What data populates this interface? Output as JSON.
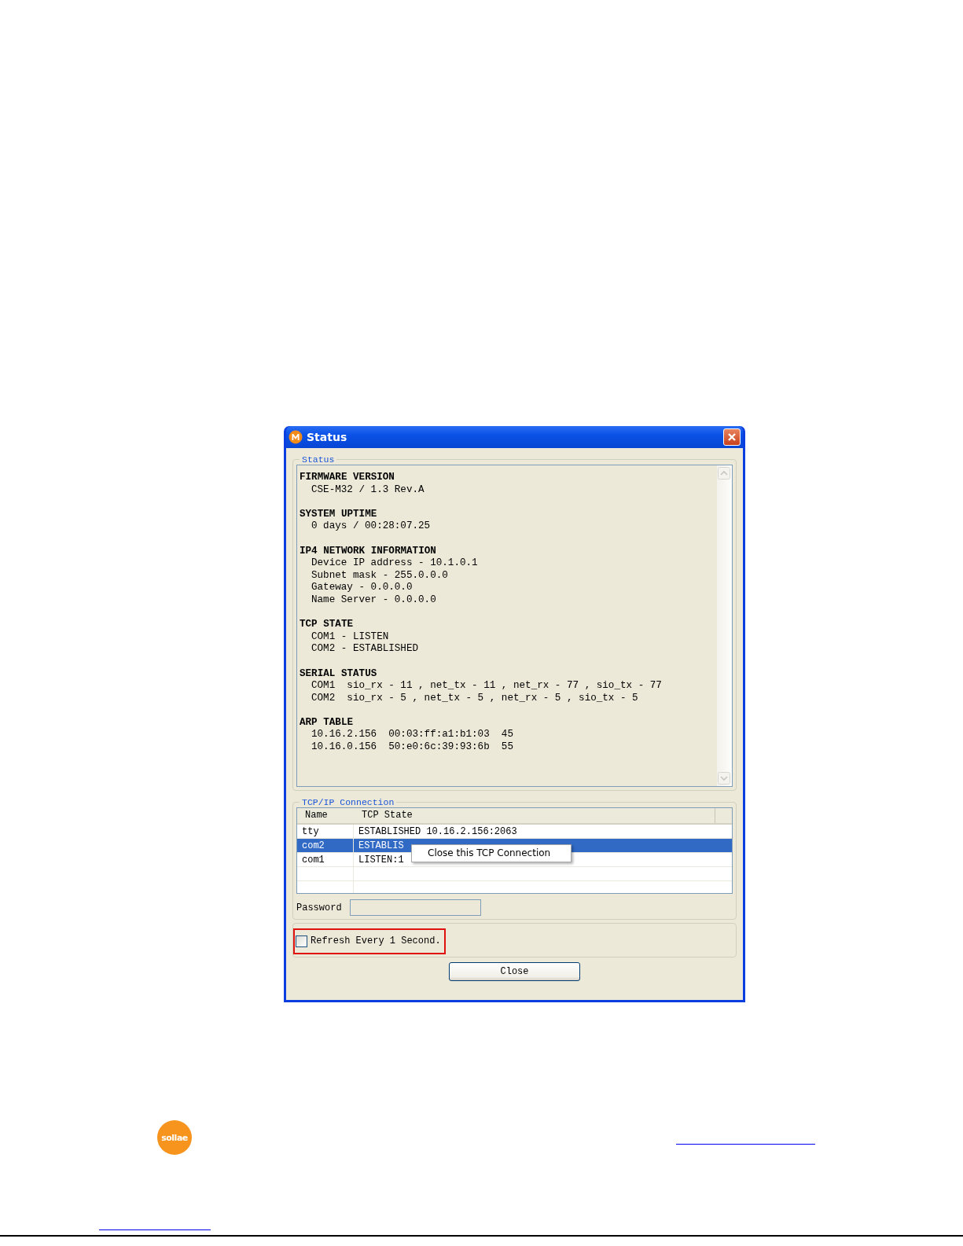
{
  "window": {
    "title": "Status"
  },
  "status_group": {
    "legend": "Status",
    "sections": [
      {
        "heading": "FIRMWARE VERSION",
        "lines": [
          "CSE-M32 / 1.3 Rev.A"
        ]
      },
      {
        "heading": "SYSTEM UPTIME",
        "lines": [
          "0 days / 00:28:07.25"
        ]
      },
      {
        "heading": "IP4 NETWORK INFORMATION",
        "lines": [
          "Device IP address - 10.1.0.1",
          "Subnet mask - 255.0.0.0",
          "Gateway - 0.0.0.0",
          "Name Server - 0.0.0.0"
        ]
      },
      {
        "heading": "TCP STATE",
        "lines": [
          "COM1 - LISTEN",
          "COM2 - ESTABLISHED"
        ]
      },
      {
        "heading": "SERIAL STATUS",
        "lines": [
          "COM1  sio_rx - 11 , net_tx - 11 , net_rx - 77 , sio_tx - 77",
          "COM2  sio_rx - 5 , net_tx - 5 , net_rx - 5 , sio_tx - 5"
        ]
      },
      {
        "heading": "ARP TABLE",
        "lines": [
          "10.16.2.156  00:03:ff:a1:b1:03  45",
          "10.16.0.156  50:e0:6c:39:93:6b  55"
        ]
      }
    ]
  },
  "connection_group": {
    "legend": "TCP/IP Connection",
    "columns": [
      "Name",
      "TCP State"
    ],
    "rows": [
      {
        "name": "tty",
        "state": "ESTABLISHED 10.16.2.156:2063",
        "selected": false
      },
      {
        "name": "com2",
        "state": "ESTABLIS",
        "selected": true
      },
      {
        "name": "com1",
        "state": "LISTEN:1",
        "selected": false
      }
    ],
    "context_menu": {
      "items": [
        "Close this TCP Connection"
      ]
    },
    "password_label": "Password"
  },
  "refresh": {
    "label": "Refresh Every 1 Second.",
    "checked": false
  },
  "close_button": "Close",
  "footer": {
    "logo": "sollae"
  }
}
